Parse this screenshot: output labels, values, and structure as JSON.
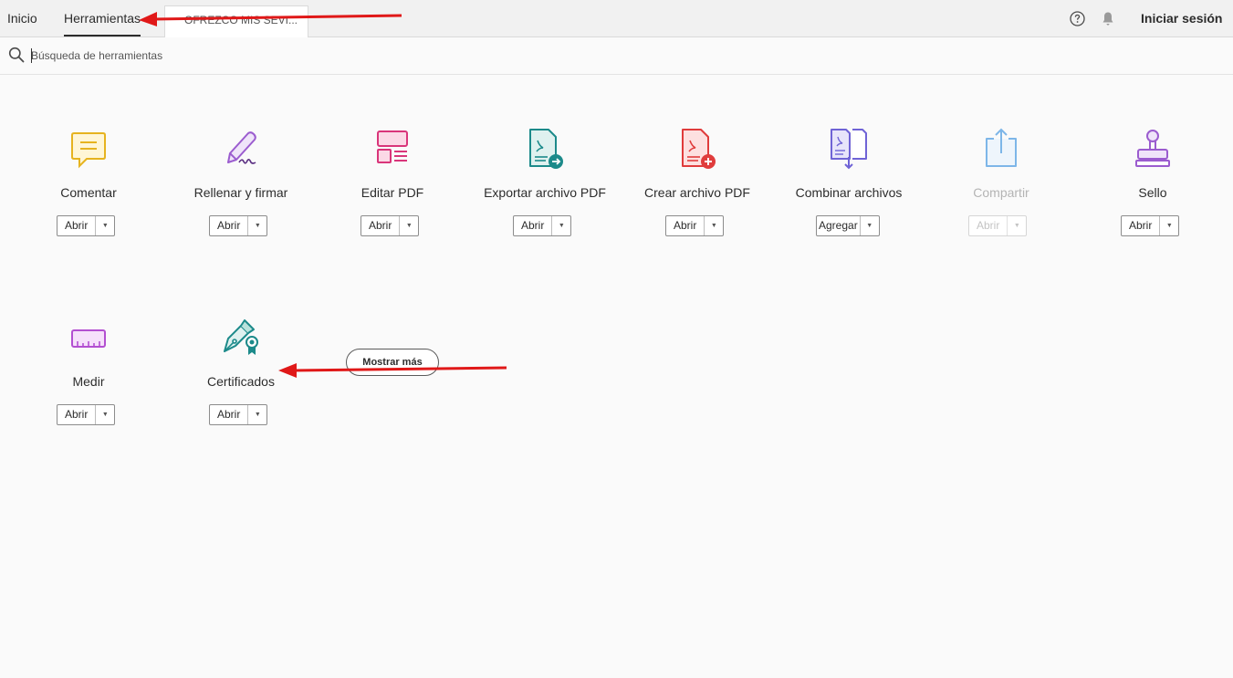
{
  "topbar": {
    "home_tab": "Inicio",
    "tools_tab": "Herramientas",
    "document_tab": "OFREZCO MIS SEVI...",
    "help_icon": "question-circle-icon",
    "bell_icon": "notification-bell-icon",
    "signin": "Iniciar sesión"
  },
  "search": {
    "placeholder": "Búsqueda de herramientas",
    "icon": "magnifier-icon"
  },
  "tools_row1": [
    {
      "label": "Comentar",
      "button": "Abrir",
      "icon": "comment-icon",
      "color": "#e6b31e"
    },
    {
      "label": "Rellenar y firmar",
      "button": "Abrir",
      "icon": "fill-sign-pen-icon",
      "color": "#9b5ccf"
    },
    {
      "label": "Editar PDF",
      "button": "Abrir",
      "icon": "edit-pdf-icon",
      "color": "#d9357a"
    },
    {
      "label": "Exportar archivo PDF",
      "button": "Abrir",
      "icon": "export-pdf-icon",
      "color": "#1c8a8a"
    },
    {
      "label": "Crear archivo PDF",
      "button": "Abrir",
      "icon": "create-pdf-icon",
      "color": "#e03c3c"
    },
    {
      "label": "Combinar archivos",
      "button": "Agregar",
      "icon": "combine-files-icon",
      "color": "#6f63d6"
    },
    {
      "label": "Compartir",
      "button": "Abrir",
      "icon": "share-upload-icon",
      "color": "#7db6e8",
      "disabled": true
    },
    {
      "label": "Sello",
      "button": "Abrir",
      "icon": "stamp-icon",
      "color": "#9b5ccf"
    }
  ],
  "tools_row2": [
    {
      "label": "Medir",
      "button": "Abrir",
      "icon": "ruler-icon",
      "color": "#b34fd1"
    },
    {
      "label": "Certificados",
      "button": "Abrir",
      "icon": "certificate-pen-icon",
      "color": "#1c8a8a"
    }
  ],
  "show_more": "Mostrar más",
  "annotations": {
    "arrow_color": "#e01818"
  }
}
